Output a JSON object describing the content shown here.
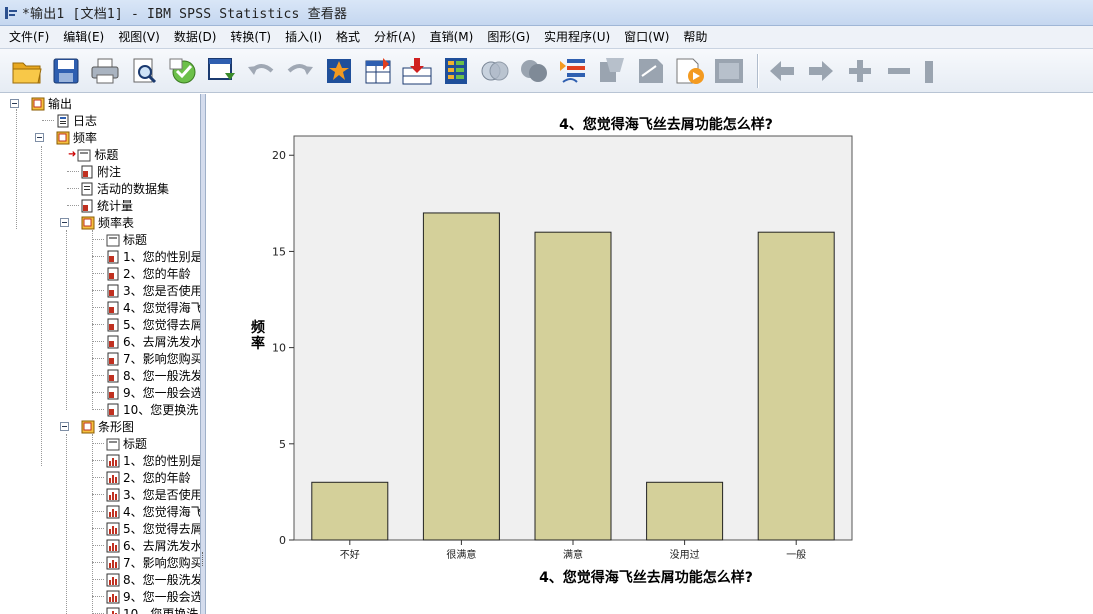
{
  "window": {
    "title": "*输出1 [文档1] - IBM SPSS Statistics 查看器"
  },
  "menu": {
    "items": [
      "文件(F)",
      "编辑(E)",
      "视图(V)",
      "数据(D)",
      "转换(T)",
      "插入(I)",
      "格式",
      "分析(A)",
      "直销(M)",
      "图形(G)",
      "实用程序(U)",
      "窗口(W)",
      "帮助"
    ]
  },
  "toolbar": {
    "icons": [
      "open-folder-icon",
      "save-icon",
      "print-icon",
      "print-preview-icon",
      "export-icon",
      "recall-dialog-icon",
      "undo-icon",
      "redo-icon",
      "goto-data-icon",
      "goto-case-icon",
      "insert-variable-icon",
      "variables-icon",
      "select-cases-icon",
      "weight-cases-icon",
      "split-file-icon",
      "designate-window-icon",
      "show-all-icon",
      "hide-icon",
      "insert-output-icon",
      "promote-icon",
      "demote-icon",
      "expand-icon",
      "collapse-icon"
    ]
  },
  "nav": {
    "root": "输出",
    "log": "日志",
    "freq": "频率",
    "freq_children": [
      "标题",
      "附注",
      "活动的数据集",
      "统计量"
    ],
    "freq_table": "频率表",
    "table_items": [
      "标题",
      "1、您的性别是",
      "2、您的年龄",
      "3、您是否使用",
      "4、您觉得海飞",
      "5、您觉得去屑",
      "6、去屑洗发水",
      "7、影响您购买",
      "8、您一般洗发",
      "9、您一般会选",
      "10、您更换洗"
    ],
    "bar_chart": "条形图",
    "chart_items": [
      "标题",
      "1、您的性别是",
      "2、您的年龄",
      "3、您是否使用",
      "4、您觉得海飞",
      "5、您觉得去屑",
      "6、去屑洗发水",
      "7、影响您购买",
      "8、您一般洗发",
      "9、您一般会选",
      "10、您更换洗"
    ]
  },
  "colors": {
    "bar_fill": "#d4d09a",
    "plot_bg": "#f0f0f0",
    "selection_arrow": "#cc0000"
  },
  "chart_data": {
    "type": "bar",
    "title": "4、您觉得海飞丝去屑功能怎么样?",
    "xlabel": "4、您觉得海飞丝去屑功能怎么样?",
    "ylabel": "频率",
    "categories": [
      "不好",
      "很满意",
      "满意",
      "没用过",
      "一般"
    ],
    "values": [
      3,
      17,
      16,
      3,
      16
    ],
    "ylim": [
      0,
      21
    ],
    "yticks": [
      0,
      5,
      10,
      15,
      20
    ],
    "grid": false
  }
}
